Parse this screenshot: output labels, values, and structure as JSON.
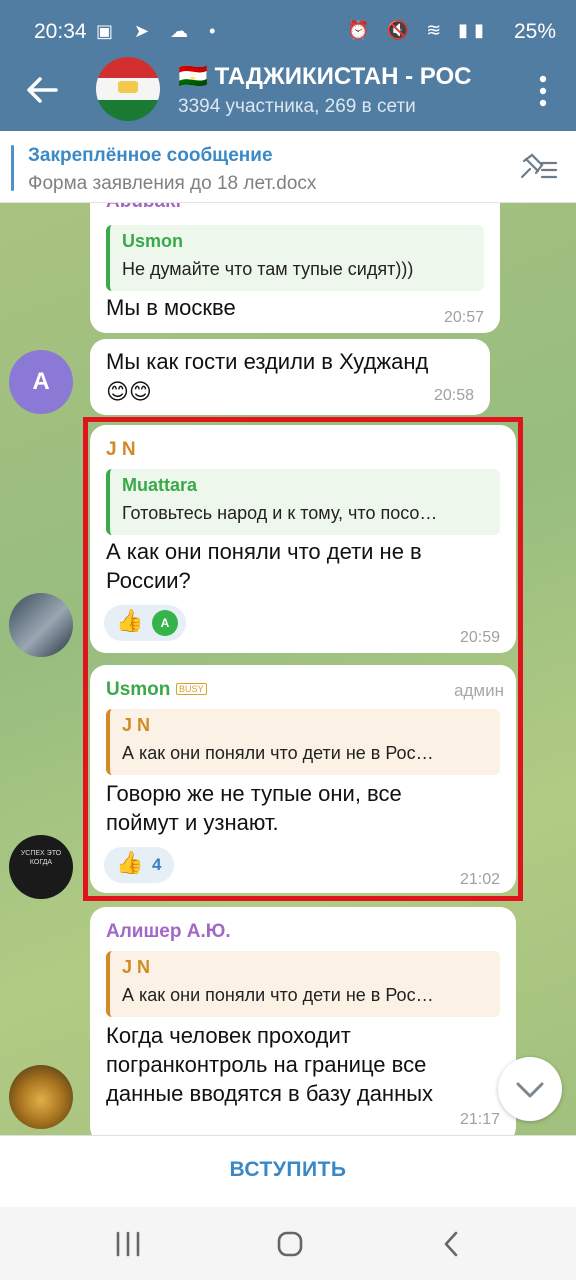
{
  "status_bar": {
    "time": "20:34",
    "battery": "25%"
  },
  "header": {
    "flag": "🇹🇯",
    "title": "ТАДЖИКИСТАН - РОС",
    "subtitle": "3394 участника, 269 в сети"
  },
  "pinned": {
    "label": "Закреплённое сообщение",
    "text": "Форма заявления до 18 лет.docx"
  },
  "messages": [
    {
      "sender": "Abubakr",
      "quote_name": "Usmon",
      "quote_text": "Не думайте что там тупые сидят)))",
      "text": "Мы в москве",
      "time": "20:57"
    },
    {
      "avatar_letter": "A",
      "text": "Мы как гости ездили в Худжанд",
      "emoji": "😊😊",
      "time": "20:58"
    },
    {
      "sender": "J N",
      "quote_name": "Muattara",
      "quote_text": "Готовьтесь народ и к тому, что посо…",
      "text_line1": "А как они поняли что дети не в",
      "text_line2": "России?",
      "reaction_emoji": "👍",
      "reaction_avatar": "A",
      "time": "20:59"
    },
    {
      "sender": "Usmon",
      "badge": "BUSY",
      "role": "админ",
      "quote_name": "J N",
      "quote_text": "А как они поняли что дети не в Рос…",
      "text_line1": "Говорю же не тупые они, все",
      "text_line2": "поймут и узнают.",
      "reaction_emoji": "👍",
      "reaction_count": "4",
      "time": "21:02"
    },
    {
      "sender": "Алишер А.Ю.",
      "quote_name": "J N",
      "quote_text": "А как они поняли что дети не в Рос…",
      "text_line1": "Когда человек проходит",
      "text_line2": "погранконтроль на границе все",
      "text_line3": "данные вводятся в базу данных",
      "time": "21:17"
    }
  ],
  "avatar_text": "УСПЕХ ЭТО КОГДА",
  "join_label": "ВСТУПИТЬ",
  "colors": {
    "header": "#527da3",
    "accent": "#3b88c6",
    "highlight": "#e0141c"
  }
}
